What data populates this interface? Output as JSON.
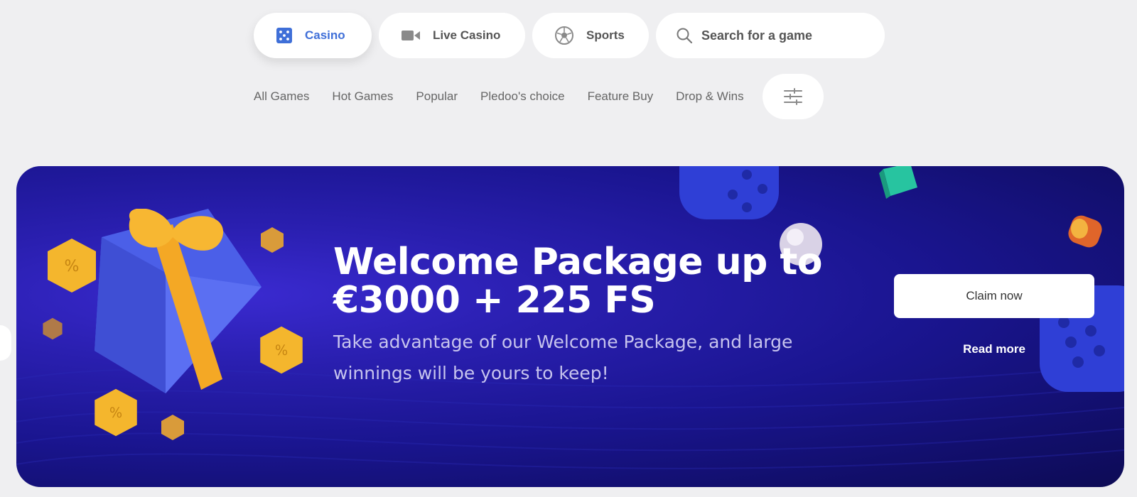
{
  "top_nav": {
    "casino": "Casino",
    "live_casino": "Live Casino",
    "sports": "Sports",
    "search_placeholder": "Search for a game"
  },
  "sub_nav": [
    "All Games",
    "Hot Games",
    "Popular",
    "Pledoo's choice",
    "Feature Buy",
    "Drop & Wins"
  ],
  "icons": {
    "casino": "dice-icon",
    "live_casino": "video-camera-icon",
    "sports": "soccer-ball-icon",
    "search": "search-icon",
    "filter": "sliders-icon"
  },
  "banner": {
    "title_line1": "Welcome Package up to",
    "title_line2": "€3000 + 225 FS",
    "desc_line1": "Take advantage of our Welcome Package, and large",
    "desc_line2": "winnings will be yours to keep!",
    "claim_label": "Claim now",
    "read_more_label": "Read more"
  },
  "colors": {
    "accent": "#3f6fd8",
    "banner_bg": "#1a1590",
    "page_bg": "#efeff1",
    "gift": "#4b5fe8",
    "ribbon": "#f4a825"
  }
}
